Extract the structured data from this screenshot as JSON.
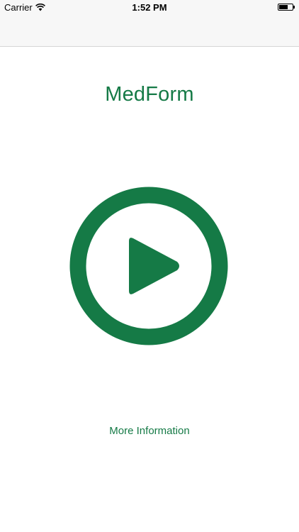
{
  "status_bar": {
    "carrier": "Carrier",
    "time": "1:52 PM",
    "icons": [
      "wifi-icon",
      "battery-icon"
    ]
  },
  "main": {
    "title": "MedForm",
    "play_icon": "play-circle-icon",
    "more_info_label": "More Information"
  },
  "colors": {
    "accent": "#157a46",
    "bar_background": "#f7f7f7"
  }
}
